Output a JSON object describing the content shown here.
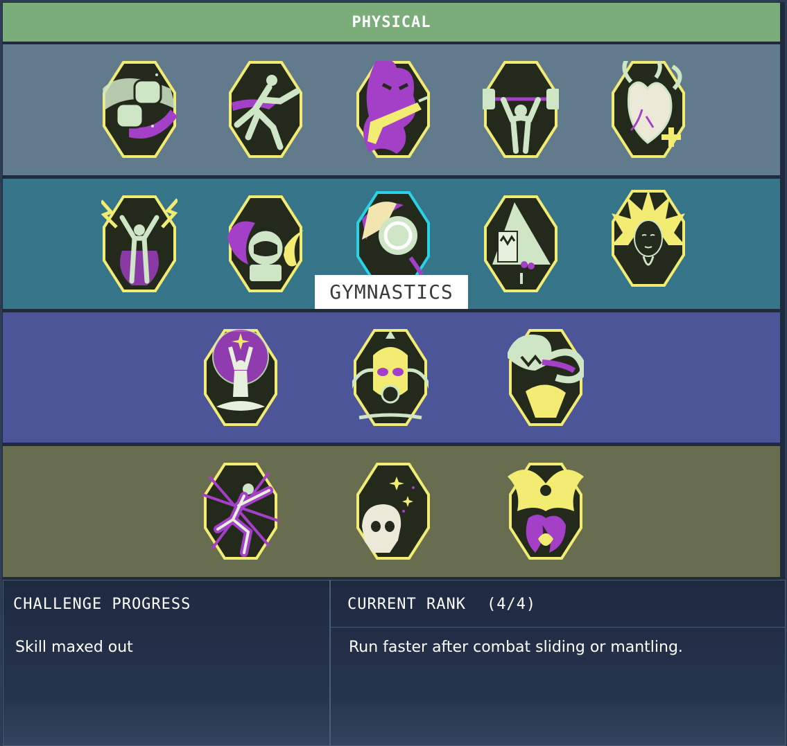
{
  "header": {
    "title": "PHYSICAL"
  },
  "colors": {
    "header_bg": "#7aad7a",
    "row_1": "#617b8c",
    "row_2": "#36748a",
    "row_3": "#4b5597",
    "row_4": "#696d50",
    "badge_border": "#f2ec72",
    "badge_fill": "#232a1c",
    "icon_light": "#cfe6c6",
    "icon_accent": "#a43fc8",
    "selected_border": "#28d3e6",
    "panel_bg": "#1e2a40"
  },
  "perk_grid": {
    "rows": [
      {
        "perks": [
          {
            "icon": "fists-icon"
          },
          {
            "icon": "sprinter-icon"
          },
          {
            "icon": "flame-pistol-icon"
          },
          {
            "icon": "weightlifter-icon"
          },
          {
            "icon": "heart-icon"
          }
        ]
      },
      {
        "perks": [
          {
            "icon": "lightning-figure-icon"
          },
          {
            "icon": "astronaut-icon"
          },
          {
            "icon": "gymnast-icon",
            "selected": true
          },
          {
            "icon": "milk-carton-icon"
          },
          {
            "icon": "lotus-face-icon"
          }
        ]
      },
      {
        "perks": [
          {
            "icon": "meditation-icon"
          },
          {
            "icon": "gas-mask-icon"
          },
          {
            "icon": "snake-icon"
          }
        ]
      },
      {
        "perks": [
          {
            "icon": "acrobat-icon"
          },
          {
            "icon": "skull-icon"
          },
          {
            "icon": "phoenix-icon"
          }
        ]
      }
    ]
  },
  "tooltip": {
    "label": "GYMNASTICS"
  },
  "challenge": {
    "title": "CHALLENGE PROGRESS",
    "status": "Skill maxed out"
  },
  "rank": {
    "title": "CURRENT RANK",
    "count": "(4/4)",
    "description": "Run faster after combat sliding or mantling."
  }
}
